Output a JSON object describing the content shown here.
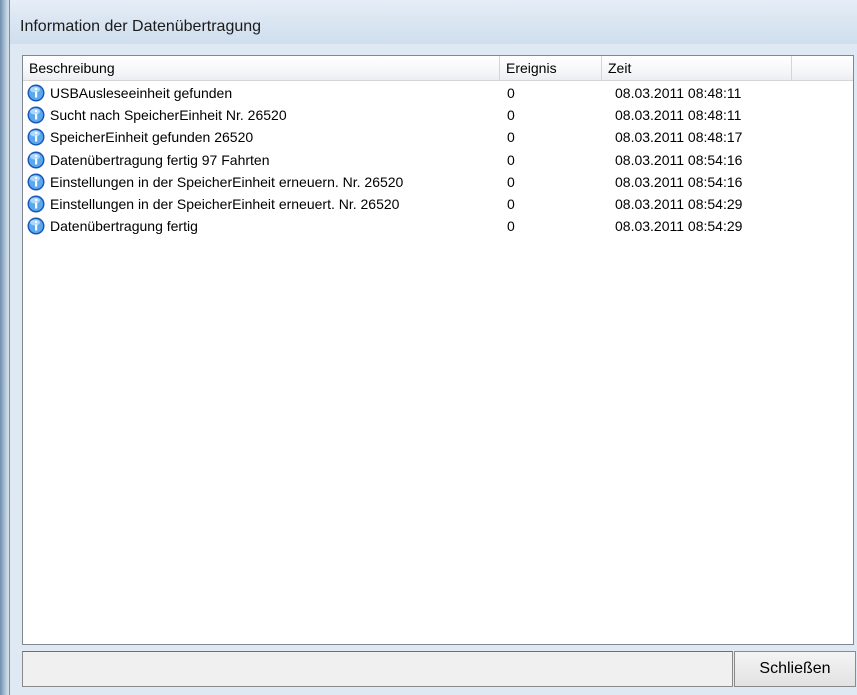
{
  "window": {
    "title": "Information der Datenübertragung"
  },
  "list": {
    "columns": {
      "description": "Beschreibung",
      "event": "Ereignis",
      "time": "Zeit"
    },
    "rows": [
      {
        "icon": "info-icon",
        "description": "USBAusleseeinheit gefunden",
        "event": "0",
        "time": "08.03.2011 08:48:11"
      },
      {
        "icon": "info-icon",
        "description": "Sucht nach SpeicherEinheit Nr. 26520",
        "event": "0",
        "time": "08.03.2011 08:48:11"
      },
      {
        "icon": "info-icon",
        "description": "SpeicherEinheit gefunden 26520",
        "event": "0",
        "time": "08.03.2011 08:48:17"
      },
      {
        "icon": "info-icon",
        "description": "Datenübertragung fertig 97 Fahrten",
        "event": "0",
        "time": "08.03.2011 08:54:16"
      },
      {
        "icon": "info-icon",
        "description": "Einstellungen in der SpeicherEinheit erneuern. Nr. 26520",
        "event": "0",
        "time": "08.03.2011 08:54:16"
      },
      {
        "icon": "info-icon",
        "description": "Einstellungen in der SpeicherEinheit erneuert. Nr. 26520",
        "event": "0",
        "time": "08.03.2011 08:54:29"
      },
      {
        "icon": "info-icon",
        "description": "Datenübertragung fertig",
        "event": "0",
        "time": "08.03.2011 08:54:29"
      }
    ]
  },
  "footer": {
    "status_text": "",
    "close_label": "Schließen"
  },
  "colors": {
    "info_icon_outer": "#1a56b8",
    "info_icon_inner": "#5aa9ee"
  }
}
